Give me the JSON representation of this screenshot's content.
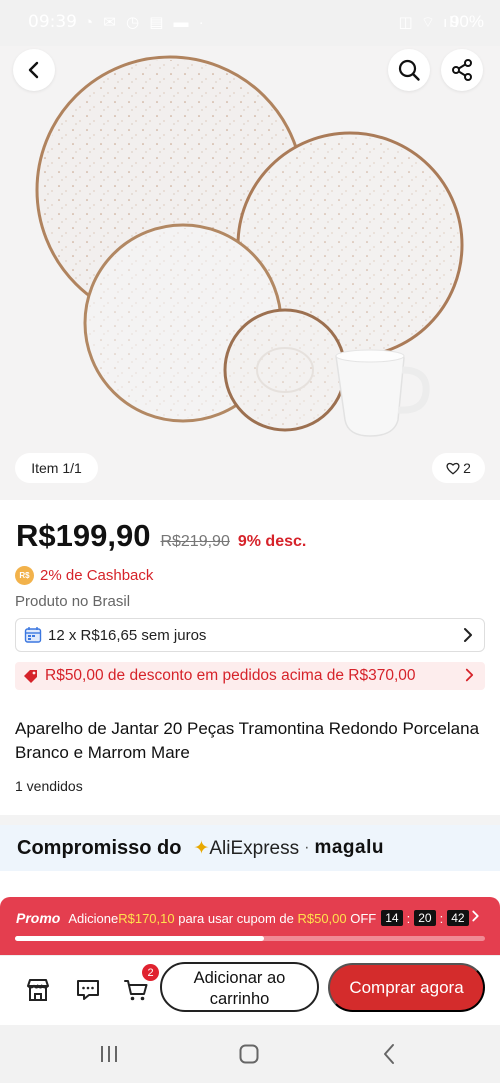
{
  "status_bar": {
    "time": "09:39",
    "battery": "90%"
  },
  "gallery": {
    "item_counter": "Item 1/1",
    "like_count": "2"
  },
  "price": {
    "current": "R$199,90",
    "original": "R$219,90",
    "discount": "9% desc."
  },
  "cashback": {
    "coin_label": "R$",
    "text": "2% de Cashback"
  },
  "origin": "Produto no Brasil",
  "installment": {
    "text": "12 x R$16,65 sem juros"
  },
  "coupon": {
    "text": "R$50,00 de desconto em pedidos acima de R$370,00"
  },
  "product": {
    "title": "Aparelho de Jantar 20 Peças Tramontina Redondo Porcelana Branco e Marrom Mare",
    "sold": "1 vendidos"
  },
  "commitment": {
    "label": "Compromisso do",
    "aliexpress": "AliExpress",
    "separator": "·",
    "magalu": "magalu"
  },
  "promo": {
    "tag": "Promo",
    "text_before": "Adicione",
    "amount_needed": "R$170,10",
    "text_middle": " para usar cupom de ",
    "coupon_value": "R$50,00",
    "text_after": " OFF",
    "timer": [
      "14",
      "20",
      "42"
    ],
    "progress": 0.53
  },
  "actions": {
    "cart_count": "2",
    "add_to_cart": "Adicionar ao carrinho",
    "buy_now": "Comprar agora"
  },
  "colors": {
    "accent_red": "#d6232a",
    "buy_button": "#d42c2c",
    "promo_bg": "#e43e4f",
    "aliexpress_a": "#e8a800"
  }
}
